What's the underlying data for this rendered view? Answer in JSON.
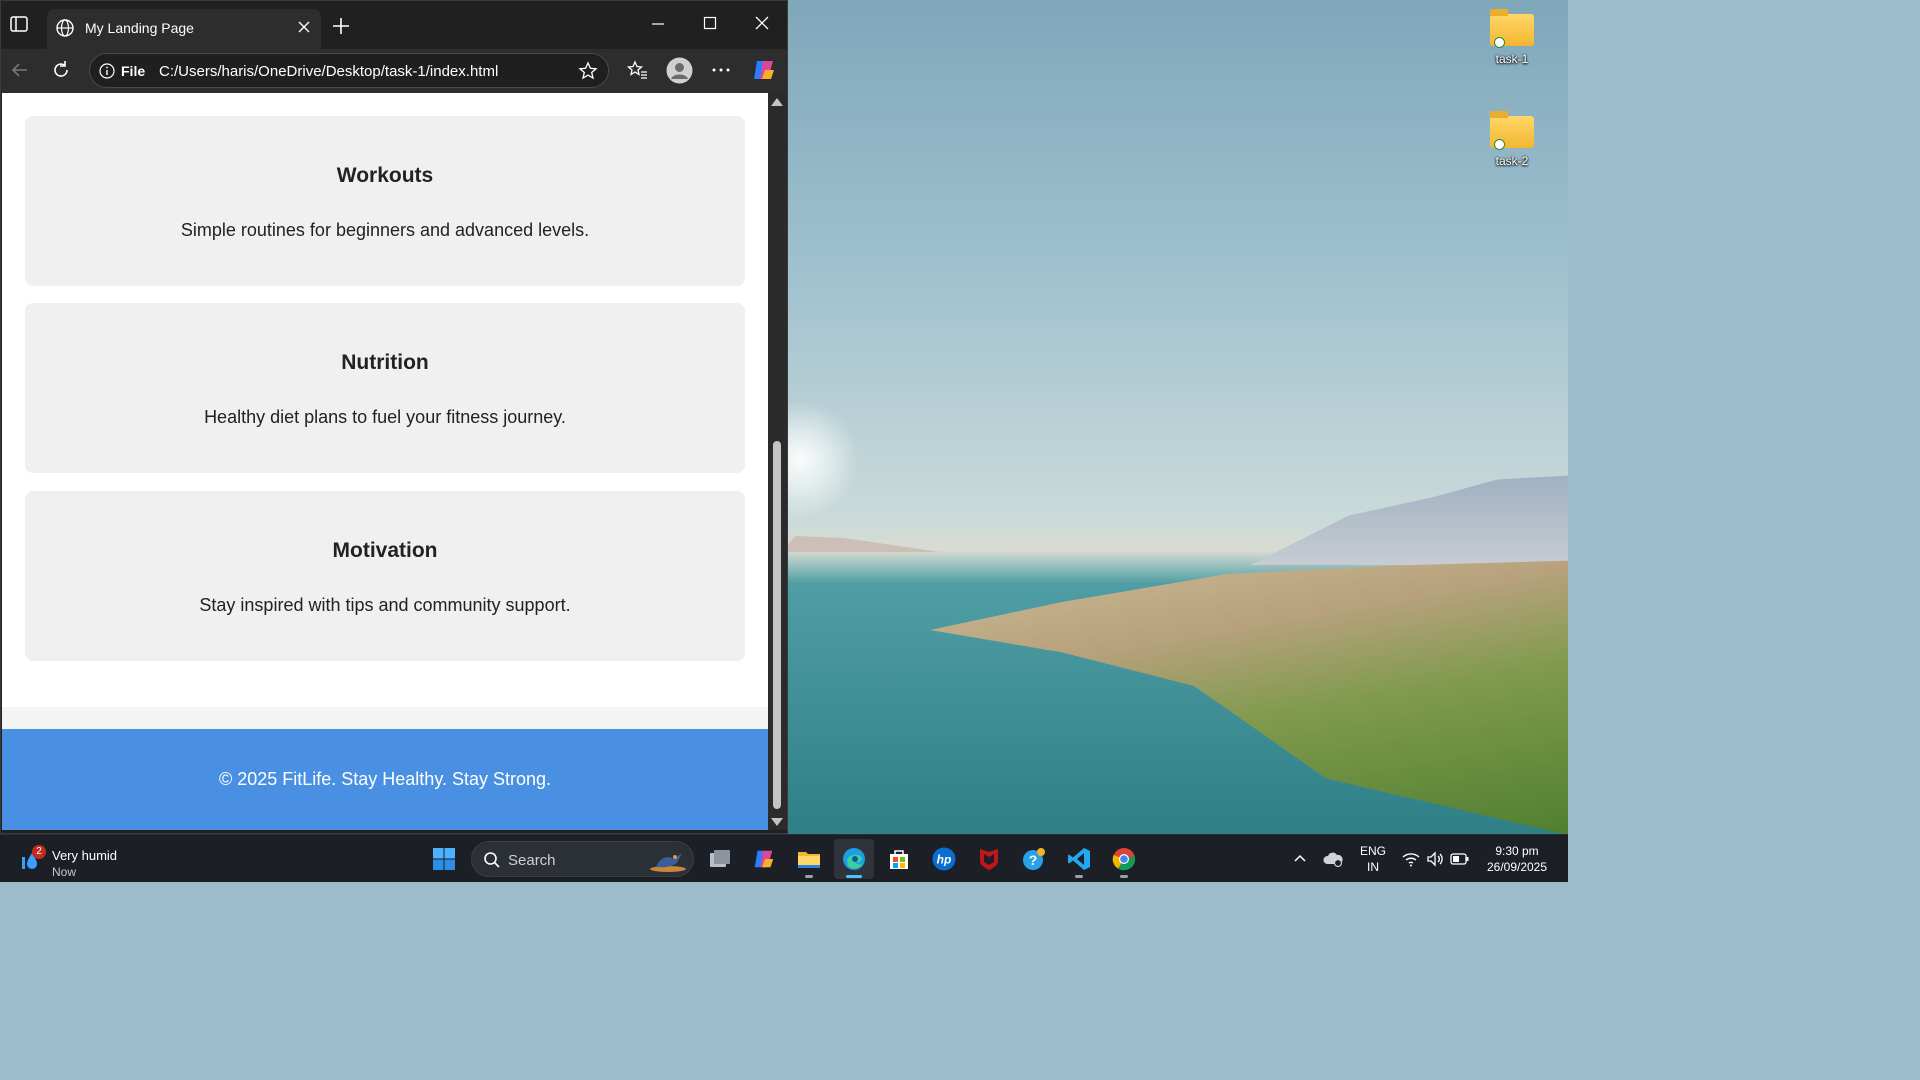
{
  "desktop": {
    "icons": [
      {
        "label": "task-1",
        "icon": "folder-icon"
      },
      {
        "label": "task-2",
        "icon": "folder-icon"
      }
    ]
  },
  "browser": {
    "tab": {
      "title": "My Landing Page",
      "favicon": "globe-icon"
    },
    "address": {
      "scheme": "File",
      "url": "C:/Users/haris/OneDrive/Desktop/task-1/index.html"
    },
    "toolbar_icons": [
      "back-icon",
      "refresh-icon",
      "favorites-icon",
      "profile-icon",
      "more-icon",
      "copilot-icon"
    ],
    "window_controls": [
      "minimize-icon",
      "maximize-icon",
      "close-icon"
    ]
  },
  "page": {
    "cards": [
      {
        "title": "Workouts",
        "text": "Simple routines for beginners and advanced levels."
      },
      {
        "title": "Nutrition",
        "text": "Healthy diet plans to fuel your fitness journey."
      },
      {
        "title": "Motivation",
        "text": "Stay inspired with tips and community support."
      }
    ],
    "footer": "© 2025 FitLife. Stay Healthy. Stay Strong.",
    "colors": {
      "card_bg": "#f0f0f0",
      "footer_bg": "#4a90e2",
      "text": "#222222"
    }
  },
  "taskbar": {
    "weather": {
      "badge": "2",
      "line1": "Very humid",
      "line2": "Now"
    },
    "search_placeholder": "Search",
    "apps": [
      "windows-start-icon",
      "task-view-icon",
      "copilot-icon",
      "file-explorer-icon",
      "edge-icon",
      "store-icon",
      "hp-icon",
      "mcafee-icon",
      "help-icon",
      "vscode-icon",
      "chrome-icon"
    ],
    "active_app": "edge-icon",
    "tray": {
      "lang1": "ENG",
      "lang2": "IN",
      "time": "9:30 pm",
      "date": "26/09/2025"
    }
  }
}
